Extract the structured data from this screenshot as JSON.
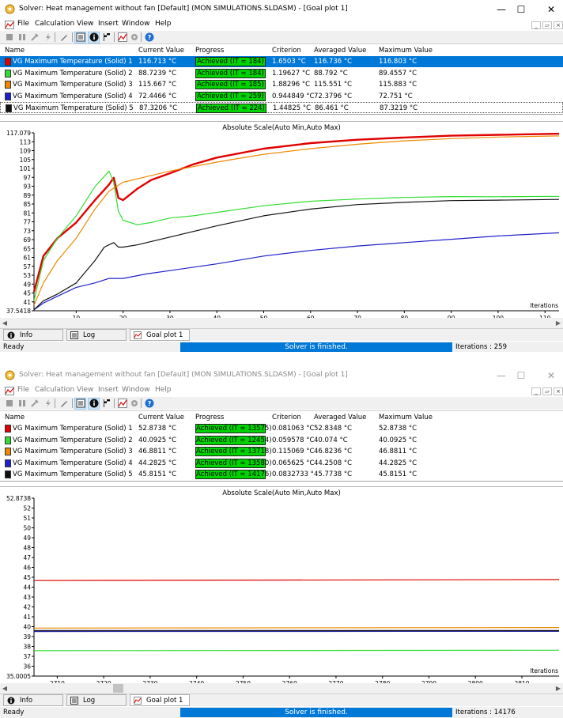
{
  "colors": {
    "s1": "#e00000",
    "s2": "#33dd33",
    "s3": "#ee8800",
    "s4": "#2020c8",
    "s5": "#111111",
    "achieved": "#00d400",
    "selection": "#0078d7"
  },
  "icons": [
    "solver-app-icon",
    "minimize-icon",
    "maximize-icon",
    "close-icon",
    "stop-icon",
    "pause-icon",
    "wrench-icon",
    "lightning-icon",
    "pen-icon",
    "list-icon",
    "info-icon",
    "plot-icon",
    "flag-icon",
    "help-icon",
    "log-icon"
  ],
  "windows": [
    {
      "title": "Solver: Heat management without fan [Default] (MON SIMULATIONS.SLDASM) - [Goal plot 1]",
      "menu": [
        "File",
        "Calculation",
        "View",
        "Insert",
        "Window",
        "Help"
      ],
      "columns": [
        "Name",
        "Current Value",
        "Progress",
        "Criterion",
        "Averaged Value",
        "Maximum Value"
      ],
      "rows": [
        {
          "name": "VG Maximum Temperature (Solid) 1",
          "current": "116.713 °C",
          "progress": "Achieved (IT = 184)",
          "criterion": "1.6503 °C",
          "averaged": "116.736 °C",
          "maximum": "116.803 °C"
        },
        {
          "name": "VG Maximum Temperature (Solid) 2",
          "current": "88.7239 °C",
          "progress": "Achieved (IT = 184)",
          "criterion": "1.19627 °C",
          "averaged": "88.792 °C",
          "maximum": "89.4557 °C"
        },
        {
          "name": "VG Maximum Temperature (Solid) 3",
          "current": "115.667 °C",
          "progress": "Achieved (IT = 185)",
          "criterion": "1.88296 °C",
          "averaged": "115.551 °C",
          "maximum": "115.883 °C"
        },
        {
          "name": "VG Maximum Temperature (Solid) 4",
          "current": "72.4466 °C",
          "progress": "Achieved (IT = 259)",
          "criterion": "0.944849 °C",
          "averaged": "72.3796 °C",
          "maximum": "72.751 °C"
        },
        {
          "name": "VG Maximum Temperature (Solid) 5",
          "current": "87.3206 °C",
          "progress": "Achieved (IT = 224)",
          "criterion": "1.44825 °C",
          "averaged": "86.461 °C",
          "maximum": "87.3219 °C"
        }
      ],
      "chart_title": "Absolute Scale(Auto Min,Auto Max)",
      "tabs": [
        "Info",
        "Log",
        "Goal plot 1"
      ],
      "status": "Ready",
      "progress_text": "Solver is finished.",
      "iterations": "Iterations : 259"
    },
    {
      "title": "Solver: Heat management without fan [Default] (MON SIMULATIONS.SLDASM) - [Goal plot 1]",
      "menu": [
        "File",
        "Calculation",
        "View",
        "Insert",
        "Window",
        "Help"
      ],
      "columns": [
        "Name",
        "Current Value",
        "Progress",
        "Criterion",
        "Averaged Value",
        "Maximum Value"
      ],
      "rows": [
        {
          "name": "VG Maximum Temperature (Solid) 1",
          "current": "52.8738 °C",
          "progress": "Achieved (IT = 13575)",
          "criterion": "0.081063 °C",
          "averaged": "52.8348 °C",
          "maximum": "52.8738 °C"
        },
        {
          "name": "VG Maximum Temperature (Solid) 2",
          "current": "40.0925 °C",
          "progress": "Achieved (IT = 12454)",
          "criterion": "0.059578 °C",
          "averaged": "40.074 °C",
          "maximum": "40.0925 °C"
        },
        {
          "name": "VG Maximum Temperature (Solid) 3",
          "current": "46.8811 °C",
          "progress": "Achieved (IT = 13718)",
          "criterion": "0.115069 °C",
          "averaged": "46.8236 °C",
          "maximum": "46.8811 °C"
        },
        {
          "name": "VG Maximum Temperature (Solid) 4",
          "current": "44.2825 °C",
          "progress": "Achieved (IT = 13580)",
          "criterion": "0.065625 °C",
          "averaged": "44.2508 °C",
          "maximum": "44.2825 °C"
        },
        {
          "name": "VG Maximum Temperature (Solid) 5",
          "current": "45.8151 °C",
          "progress": "Achieved (IT = 14176)",
          "criterion": "0.0832733 °",
          "averaged": "45.7738 °C",
          "maximum": "45.8151 °C"
        }
      ],
      "chart_title": "Absolute Scale(Auto Min,Auto Max)",
      "tabs": [
        "Info",
        "Log",
        "Goal plot 1"
      ],
      "status": "Ready",
      "progress_text": "Solver is finished.",
      "iterations": "Iterations : 14176"
    }
  ],
  "chart_data": [
    {
      "type": "line",
      "title": "Absolute Scale(Auto Min,Auto Max)",
      "xlabel": "Iterations",
      "ylabel": "",
      "xlim": [
        1,
        113
      ],
      "ylim": [
        37.5418,
        117.079
      ],
      "xticks": [
        10,
        20,
        30,
        40,
        50,
        60,
        70,
        80,
        90,
        100,
        110
      ],
      "yticks_labels": [
        "117.079",
        "113",
        "109",
        "105",
        "101",
        "97",
        "93",
        "89",
        "85",
        "81",
        "77",
        "73",
        "69",
        "65",
        "61",
        "57",
        "53",
        "49",
        "45",
        "41",
        "37.5418"
      ],
      "series": [
        {
          "color": "#e00000",
          "x": [
            1,
            3,
            6,
            10,
            14,
            17,
            18,
            19,
            20,
            23,
            26,
            30,
            35,
            40,
            50,
            60,
            70,
            80,
            90,
            100,
            113
          ],
          "y": [
            46,
            62,
            70,
            77,
            87,
            94,
            97,
            88,
            87,
            92,
            96,
            99,
            103,
            106,
            110,
            112.5,
            114,
            115,
            115.8,
            116.2,
            116.7
          ]
        },
        {
          "color": "#33dd33",
          "x": [
            1,
            3,
            6,
            10,
            14,
            17,
            18,
            19,
            20,
            23,
            26,
            30,
            35,
            40,
            50,
            60,
            70,
            80,
            90,
            100,
            113
          ],
          "y": [
            42,
            60,
            70,
            80,
            93,
            100,
            95,
            82,
            78,
            76,
            77,
            79,
            80,
            81.5,
            84.5,
            86.5,
            87.5,
            88.2,
            88.6,
            88.5,
            88.7
          ]
        },
        {
          "color": "#ee8800",
          "x": [
            1,
            3,
            6,
            10,
            14,
            17,
            20,
            25,
            30,
            35,
            40,
            50,
            60,
            70,
            80,
            90,
            100,
            113
          ],
          "y": [
            40,
            50,
            60,
            70,
            83,
            91,
            95,
            97.5,
            100,
            102,
            104,
            107.5,
            110,
            112,
            113.5,
            114.5,
            115.2,
            115.7
          ]
        },
        {
          "color": "#2020c8",
          "x": [
            1,
            3,
            6,
            10,
            14,
            17,
            20,
            25,
            30,
            40,
            50,
            60,
            70,
            80,
            90,
            100,
            113
          ],
          "y": [
            38,
            41,
            44,
            48,
            50,
            52,
            52,
            54,
            55.5,
            58.5,
            62,
            64.5,
            66.5,
            68,
            69.5,
            71,
            72.4
          ]
        },
        {
          "color": "#111111",
          "x": [
            1,
            3,
            6,
            10,
            14,
            16,
            18,
            19,
            20,
            23,
            26,
            30,
            35,
            40,
            50,
            60,
            70,
            80,
            90,
            100,
            113
          ],
          "y": [
            38,
            42,
            45,
            50,
            60,
            66,
            68,
            66,
            66,
            67,
            68.5,
            70.5,
            73,
            75.5,
            80,
            83,
            85,
            86,
            86.8,
            87,
            87.3
          ]
        }
      ]
    },
    {
      "type": "line",
      "title": "Absolute Scale(Auto Min,Auto Max)",
      "xlabel": "Iterations",
      "ylabel": "",
      "xlim": [
        2705,
        2818
      ],
      "ylim": [
        35.0005,
        52.8738
      ],
      "xticks": [
        2710,
        2720,
        2730,
        2740,
        2750,
        2760,
        2770,
        2780,
        2790,
        2800,
        2810
      ],
      "yticks_labels": [
        "52.8738",
        "52",
        "51",
        "50",
        "49",
        "48",
        "47",
        "46",
        "45",
        "44",
        "43",
        "42",
        "41",
        "40",
        "39",
        "38",
        "37",
        "36",
        "35.0005"
      ],
      "series": [
        {
          "color": "#e00000",
          "x": [
            2705,
            2818
          ],
          "y": [
            44.6,
            44.7
          ]
        },
        {
          "color": "#ee8800",
          "x": [
            2705,
            2818
          ],
          "y": [
            39.82,
            39.88
          ]
        },
        {
          "color": "#9090a8",
          "x": [
            2705,
            2818
          ],
          "y": [
            39.6,
            39.6
          ]
        },
        {
          "color": "#2020c8",
          "x": [
            2705,
            2818
          ],
          "y": [
            39.48,
            39.5
          ]
        },
        {
          "color": "#111111",
          "x": [
            2705,
            2818
          ],
          "y": [
            39.55,
            39.56
          ]
        },
        {
          "color": "#33dd33",
          "x": [
            2705,
            2818
          ],
          "y": [
            37.55,
            37.6
          ]
        }
      ]
    }
  ]
}
